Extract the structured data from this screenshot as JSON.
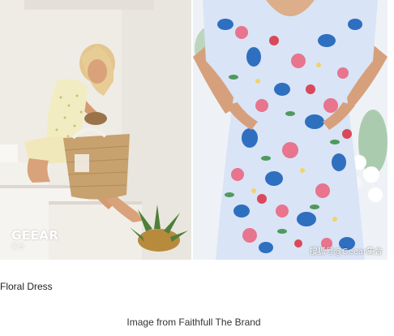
{
  "images": {
    "left": {
      "alt": "Woman in floral dress sitting on white steps with woven basket and pineapple",
      "watermark": "GEEAR",
      "watermark_sub": "集合"
    },
    "right": {
      "alt": "Floral print puff-sleeve dress close-up",
      "watermark": "搜狐号@Geear集合"
    }
  },
  "content": {
    "product_label": "Floral Dress",
    "caption": "Image from Faithfull The Brand"
  },
  "colors": {
    "wall": "#efece6",
    "steps": "#f6f4f0",
    "skin": "#d9a27a",
    "hair": "#e3c58e",
    "dress_left": "#f2ecc2",
    "basket": "#c7a16e",
    "pineapple_leaves": "#4f7f3a",
    "dress_right_base": "#d9e4f6",
    "flower_blue": "#2f6fbf",
    "flower_pink": "#e8748e",
    "flower_red": "#d8495a",
    "leaf_green": "#4e9a5e"
  }
}
